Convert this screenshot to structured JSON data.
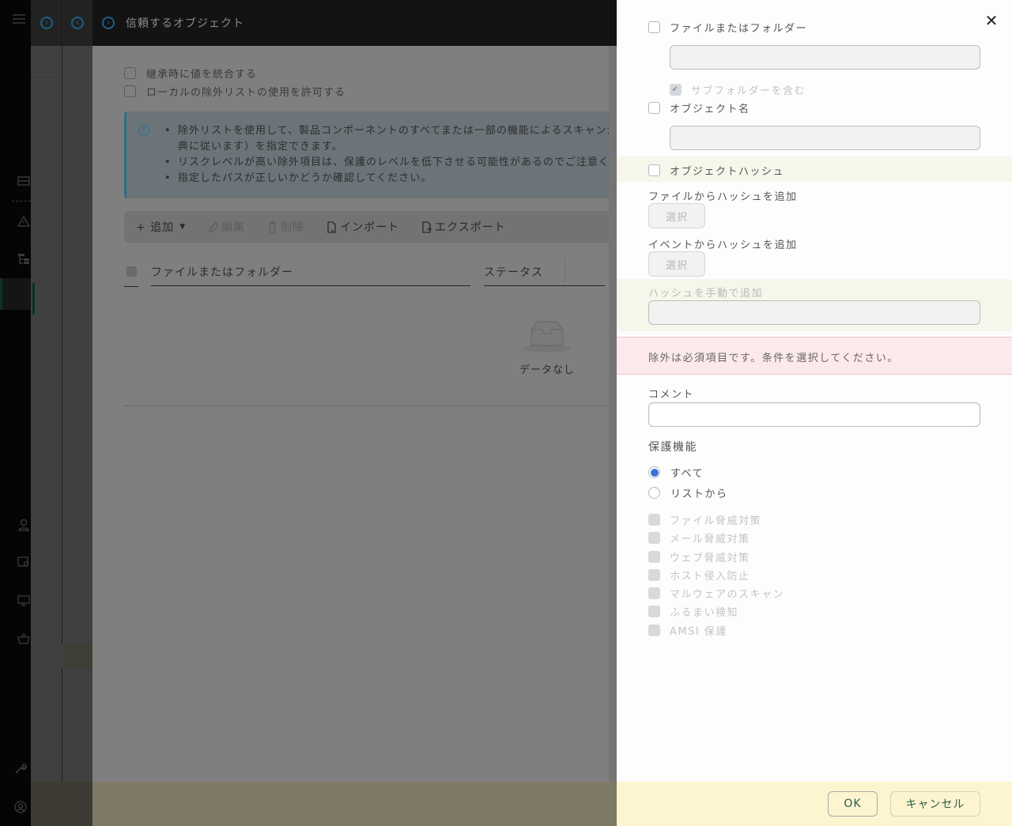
{
  "header": {
    "title": "信頼するオブジェクト"
  },
  "rail": {
    "icons": [
      "menu-icon",
      "storage-icon",
      "warning-icon",
      "hierarchy-icon",
      "user-icon",
      "settings-list-icon",
      "monitor-icon",
      "basket-icon",
      "wrench-icon",
      "account-icon"
    ]
  },
  "main": {
    "options": [
      {
        "label": "継承時に値を統合する",
        "checked": false
      },
      {
        "label": "ローカルの除外リストの使用を許可する",
        "checked": false
      }
    ],
    "info": {
      "lines": [
        "除外リストを使用して、製品コンポーネントのすべてまたは一部の機能によるスキャンか",
        "典に従います）を指定できます。",
        "リスクレベルが高い除外項目は、保護のレベルを低下させる可能性があるのでご注意くだ",
        "指定したパスが正しいかどうか確認してください。"
      ]
    },
    "toolbar": {
      "add": "+ 追加",
      "edit": "編集",
      "delete": "削除",
      "import": "インポート",
      "export": "エクスポート"
    },
    "table": {
      "columns": [
        "ファイルまたはフォルダー",
        "ステータス"
      ],
      "empty": "データなし"
    }
  },
  "panel": {
    "file_or_folder": {
      "label": "ファイルまたはフォルダー",
      "checked": false,
      "value": ""
    },
    "include_subfolders": {
      "label": "サブフォルダーを含む",
      "checked": true,
      "disabled": true
    },
    "object_name": {
      "label": "オブジェクト名",
      "checked": false,
      "value": ""
    },
    "object_hash": {
      "label": "オブジェクトハッシュ",
      "checked": false
    },
    "hash_from_file": {
      "label": "ファイルからハッシュを追加",
      "button": "選択"
    },
    "hash_from_event": {
      "label": "イベントからハッシュを追加",
      "button": "選択"
    },
    "hash_manual": {
      "label": "ハッシュを手動で追加",
      "value": ""
    },
    "error": "除外は必須項目です。条件を選択してください。",
    "comment": {
      "label": "コメント",
      "value": ""
    },
    "protection": {
      "label": "保護機能",
      "options": [
        {
          "label": "すべて",
          "selected": true
        },
        {
          "label": "リストから",
          "selected": false
        }
      ],
      "components": [
        "ファイル脅威対策",
        "メール脅威対策",
        "ウェブ脅威対策",
        "ホスト侵入防止",
        "マルウェアのスキャン",
        "ふるまい検知",
        "AMSI 保護"
      ]
    },
    "footer": {
      "ok": "OK",
      "cancel": "キャンセル"
    },
    "colors": {
      "accent_radio": "#3b73d9",
      "error_bg": "#fce9ec",
      "highlight_bg": "#f6f6ea",
      "footer_bg": "#fdf5d0"
    }
  }
}
